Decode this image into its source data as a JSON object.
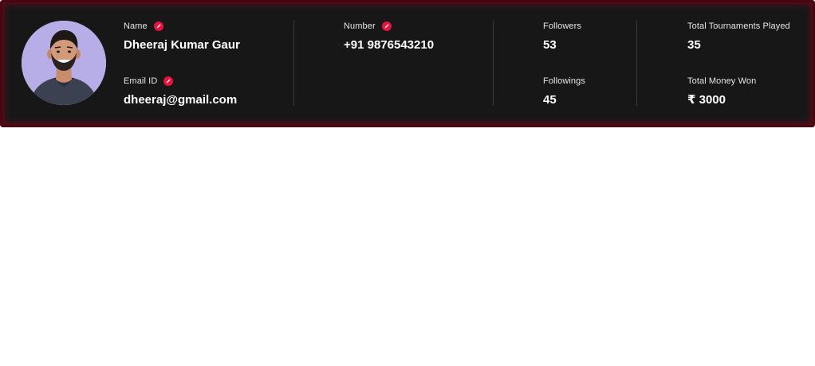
{
  "profile": {
    "name_label": "Name",
    "name_value": "Dheeraj Kumar Gaur",
    "email_label": "Email ID",
    "email_value": "dheeraj@gmail.com",
    "number_label": "Number",
    "number_value": "+91 9876543210"
  },
  "stats": {
    "followers_label": "Followers",
    "followers_value": "53",
    "followings_label": "Followings",
    "followings_value": "45",
    "tournaments_label": "Total Tournaments Played",
    "tournaments_value": "35",
    "money_label": "Total Money Won",
    "money_value": "₹ 3000"
  },
  "icons": {
    "edit": "pencil-icon"
  },
  "colors": {
    "card_background": "#171718",
    "card_glow": "#6e0a1c",
    "edit_badge": "#e8123c",
    "avatar_background": "#b7aee8"
  }
}
